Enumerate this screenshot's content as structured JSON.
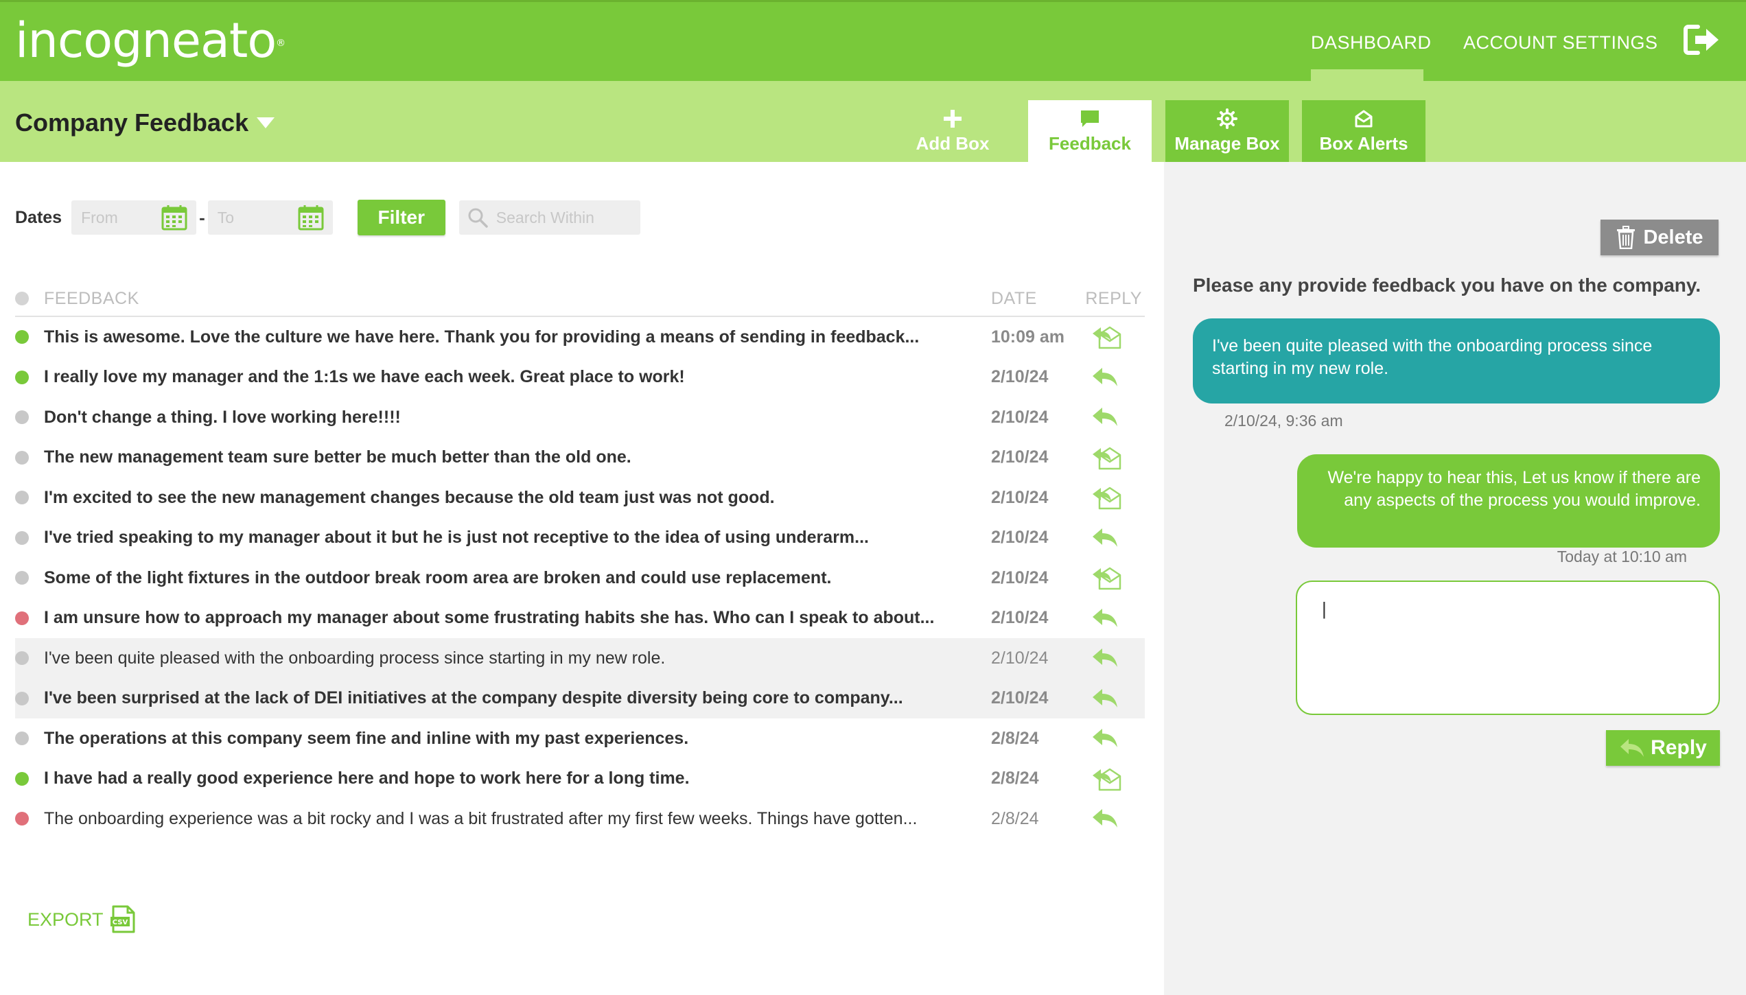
{
  "brand": {
    "logo": "incogneato",
    "trademark": "®"
  },
  "nav": {
    "dashboard": "DASHBOARD",
    "account_settings": "ACCOUNT SETTINGS",
    "logout_icon": "logout-icon"
  },
  "subheader": {
    "title": "Company Feedback",
    "tabs": {
      "add_box": "Add Box",
      "feedback": "Feedback",
      "manage_box": "Manage Box",
      "box_alerts": "Box Alerts"
    }
  },
  "filters": {
    "dates_label": "Dates",
    "from_placeholder": "From",
    "to_placeholder": "To",
    "separator": "-",
    "filter_button": "Filter",
    "search_placeholder": "Search Within"
  },
  "table": {
    "headers": {
      "feedback": "FEEDBACK",
      "date": "DATE",
      "reply": "REPLY"
    },
    "rows": [
      {
        "text": "This is awesome. Love the culture we have here. Thank you for providing a means of sending in feedback...",
        "date": "10:09 am",
        "status": "positive",
        "read": false,
        "reply": "envelope"
      },
      {
        "text": "I really love my manager and the 1:1s we have each week. Great place to work!",
        "date": "2/10/24",
        "status": "positive",
        "read": false,
        "reply": "arrow"
      },
      {
        "text": "Don't change a thing. I love working here!!!!",
        "date": "2/10/24",
        "status": "neutral",
        "read": false,
        "reply": "arrow"
      },
      {
        "text": "The new management team sure better be much better than the old one.",
        "date": "2/10/24",
        "status": "neutral",
        "read": false,
        "reply": "envelope"
      },
      {
        "text": "I'm excited to see the new management changes because the old team just was not good.",
        "date": "2/10/24",
        "status": "neutral",
        "read": false,
        "reply": "envelope"
      },
      {
        "text": "I've tried speaking to my manager about it but he is just not receptive to the idea of using underarm...",
        "date": "2/10/24",
        "status": "neutral",
        "read": false,
        "reply": "arrow"
      },
      {
        "text": "Some of the light fixtures in the outdoor break room area are broken and could use replacement.",
        "date": "2/10/24",
        "status": "neutral",
        "read": false,
        "reply": "envelope"
      },
      {
        "text": "I am unsure how to approach my manager about some frustrating habits she has. Who can I speak to about...",
        "date": "2/10/24",
        "status": "negative",
        "read": false,
        "reply": "arrow"
      },
      {
        "text": "I've been quite pleased with the onboarding process since starting in my new role.",
        "date": "2/10/24",
        "status": "neutral",
        "read": true,
        "selected": true,
        "reply": "arrow"
      },
      {
        "text": "I've been surprised at the lack of DEI initiatives at the company despite diversity being core to company...",
        "date": "2/10/24",
        "status": "neutral",
        "read": false,
        "selected": true,
        "reply": "arrow"
      },
      {
        "text": "The operations at this company seem fine and inline with my past experiences.",
        "date": "2/8/24",
        "status": "neutral",
        "read": false,
        "reply": "arrow"
      },
      {
        "text": "I have had a really good experience here and hope to work here for a long time.",
        "date": "2/8/24",
        "status": "positive",
        "read": false,
        "reply": "envelope"
      },
      {
        "text": "The onboarding experience was a bit rocky and I was a bit frustrated after my first few weeks. Things have gotten...",
        "date": "2/8/24",
        "status": "negative",
        "read": true,
        "reply": "arrow"
      }
    ]
  },
  "export": {
    "label": "EXPORT",
    "icon": "csv-file-icon"
  },
  "detail": {
    "delete_button": "Delete",
    "question": "Please any provide feedback you have on the company.",
    "incoming_message": "I've been quite pleased with the onboarding process since starting in my new role.",
    "incoming_timestamp": "2/10/24, 9:36 am",
    "outgoing_message": "We're happy to hear this, Let us know if there are any aspects of the process you would improve.",
    "outgoing_timestamp": "Today at 10:10 am",
    "reply_text": "|",
    "reply_button": "Reply"
  },
  "colors": {
    "brand_green": "#79c93a",
    "light_green": "#b9e580",
    "teal": "#26a5a5",
    "positive": "#79c93a",
    "neutral": "#c8c8c8",
    "negative": "#e0707a",
    "reply_icon": "#9ed96a"
  }
}
